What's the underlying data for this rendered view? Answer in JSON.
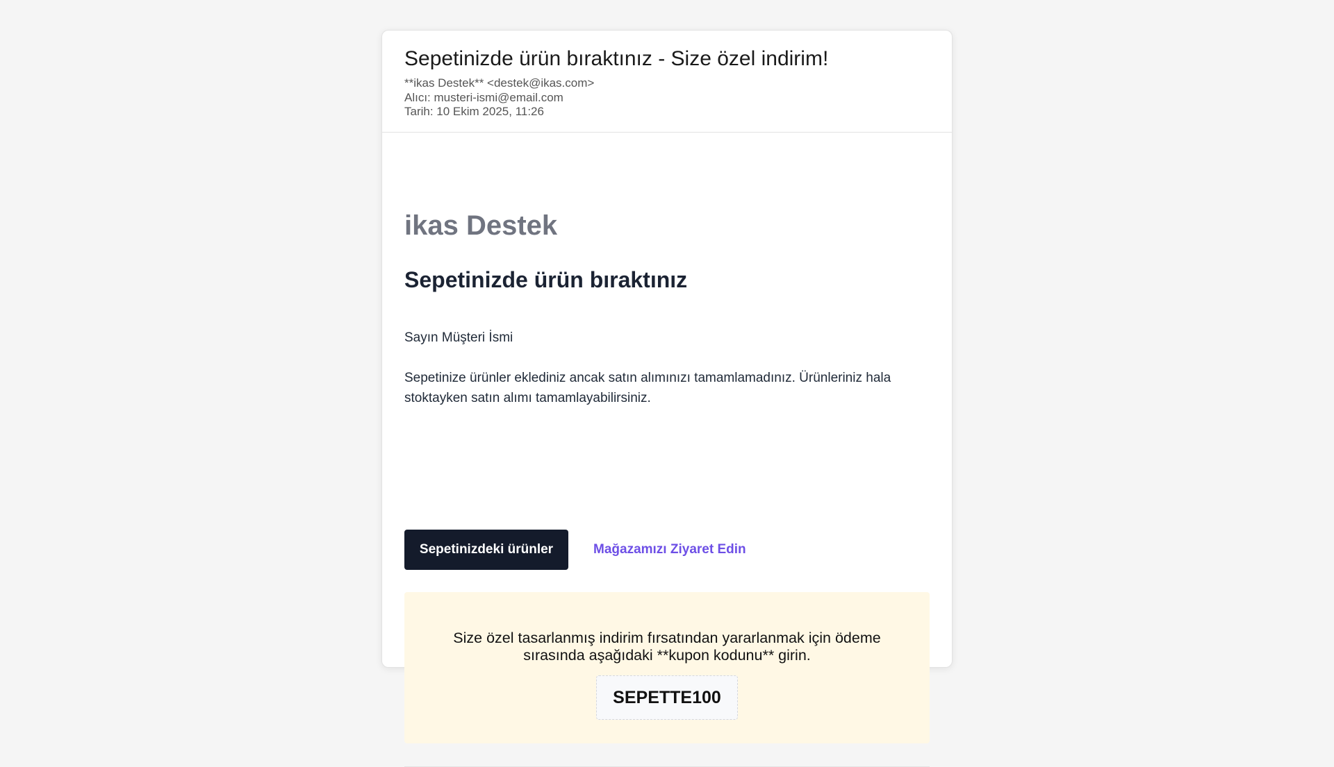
{
  "email": {
    "subject": "Sepetinizde ürün bıraktınız - Size özel indirim!",
    "from": "**ikas Destek** <destek@ikas.com>",
    "to": "Alıcı: musteri-ismi@email.com",
    "date": "Tarih: 10 Ekim 2025, 11:26"
  },
  "content": {
    "brand": "ikas Destek",
    "heading": "Sepetinizde ürün bıraktınız",
    "greeting": "Sayın Müşteri İsmi",
    "paragraph": "Sepetinize ürünler eklediniz ancak satın alımınızı tamamlamadınız. Ürünleriniz hala stoktayken satın alımı tamamlayabilirsiniz.",
    "primary_button": "Sepetinizdeki ürünler",
    "secondary_link": "Mağazamızı Ziyaret Edin"
  },
  "coupon": {
    "text": "Size özel tasarlanmış indirim fırsatından yararlanmak için ödeme sırasında aşağıdaki **kupon kodunu** girin.",
    "code": "SEPETTE100"
  },
  "colors": {
    "primary_button_bg": "#141b2b",
    "link": "#6d4fe6",
    "coupon_bg": "#fff8e5",
    "brand_text": "#707480"
  }
}
